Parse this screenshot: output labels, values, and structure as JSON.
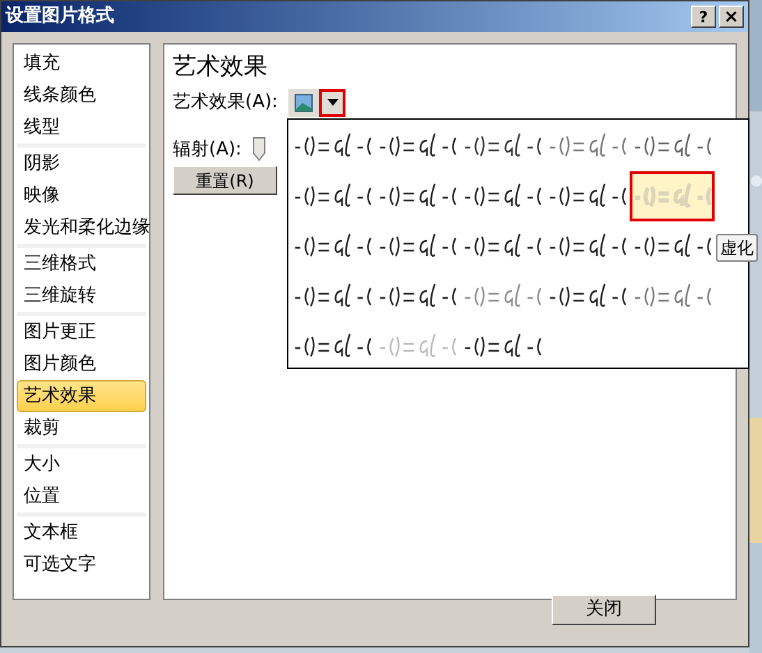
{
  "window": {
    "title": "设置图片格式",
    "help_button": "?",
    "close_button": "×"
  },
  "sidebar": {
    "groups": [
      {
        "items": [
          {
            "label": "填充",
            "selected": false
          },
          {
            "label": "线条颜色",
            "selected": false
          },
          {
            "label": "线型",
            "selected": false
          }
        ]
      },
      {
        "items": [
          {
            "label": "阴影",
            "selected": false
          },
          {
            "label": "映像",
            "selected": false
          },
          {
            "label": "发光和柔化边缘",
            "selected": false
          }
        ]
      },
      {
        "items": [
          {
            "label": "三维格式",
            "selected": false
          },
          {
            "label": "三维旋转",
            "selected": false
          }
        ]
      },
      {
        "items": [
          {
            "label": "图片更正",
            "selected": false
          },
          {
            "label": "图片颜色",
            "selected": false
          },
          {
            "label": "艺术效果",
            "selected": true
          },
          {
            "label": "裁剪",
            "selected": false
          }
        ]
      },
      {
        "items": [
          {
            "label": "大小",
            "selected": false
          },
          {
            "label": "位置",
            "selected": false
          }
        ]
      },
      {
        "items": [
          {
            "label": "文本框",
            "selected": false
          },
          {
            "label": "可选文字",
            "selected": false
          }
        ]
      }
    ]
  },
  "panel": {
    "heading": "艺术效果",
    "effect_label": "艺术效果(A):",
    "radius_label": "辐射(A):",
    "reset_button": "重置(R)"
  },
  "gallery": {
    "items": [
      {
        "kind": "picture",
        "selected": false
      },
      {
        "kind": "picture",
        "selected": false
      },
      {
        "kind": "picture",
        "selected": false
      },
      {
        "kind": "picture",
        "selected": false
      },
      {
        "kind": "picture",
        "selected": false
      },
      {
        "kind": "picture",
        "selected": false
      },
      {
        "kind": "picture",
        "selected": false
      },
      {
        "kind": "picture",
        "selected": false
      },
      {
        "kind": "picture",
        "selected": false
      },
      {
        "kind": "picture",
        "selected": true
      },
      {
        "kind": "picture",
        "selected": false
      },
      {
        "kind": "picture",
        "selected": false
      },
      {
        "kind": "picture",
        "selected": false
      },
      {
        "kind": "picture",
        "selected": false
      },
      {
        "kind": "picture",
        "selected": false
      },
      {
        "kind": "picture",
        "selected": false
      },
      {
        "kind": "picture",
        "selected": false
      },
      {
        "kind": "picture",
        "selected": false
      },
      {
        "kind": "picture",
        "selected": false
      },
      {
        "kind": "picture",
        "selected": false
      },
      {
        "kind": "picture",
        "selected": false
      },
      {
        "kind": "picture",
        "selected": false
      },
      {
        "kind": "picture",
        "selected": false
      }
    ],
    "tooltip": "虚化"
  },
  "footer": {
    "close_button": "关闭"
  }
}
